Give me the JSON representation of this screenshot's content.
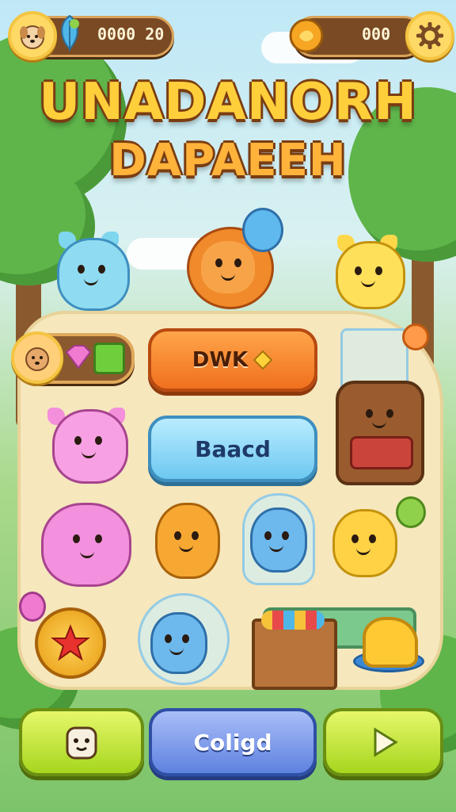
{
  "hud": {
    "left_value": "0000 20",
    "right_value": "000"
  },
  "title": {
    "line1": "UNADANORH",
    "line2": "DAPAEEH"
  },
  "main_buttons": {
    "play_label": "DWK",
    "second_label": "Baacd"
  },
  "bottom_bar": {
    "center_label": "Coligd"
  },
  "icons": {
    "left_hud": "dog-avatar-icon",
    "left_hud_secondary": "feather-icon",
    "right_hud": "acorn-coin-icon",
    "settings": "gear-icon",
    "play_button": "gem-icon",
    "left_bottom": "pet-character-icon",
    "right_bottom": "play-arrow-icon"
  },
  "colors": {
    "primary_orange": "#f0701e",
    "primary_blue": "#6cc8f0",
    "lime": "#a6d61e",
    "wood": "#7a4a24"
  }
}
